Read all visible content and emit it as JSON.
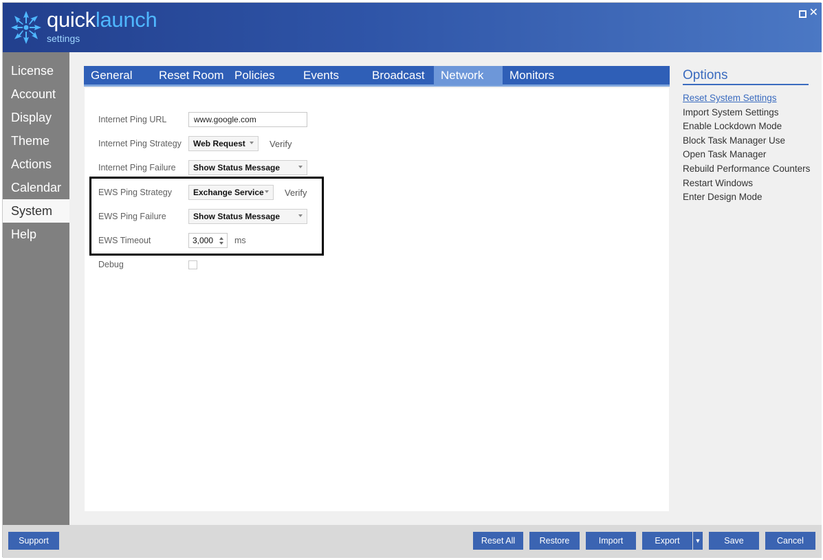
{
  "app": {
    "logo_word1": "quick",
    "logo_word2": "launch",
    "logo_subtitle": "settings",
    "window_controls": {
      "maximize_icon": "maximize-icon",
      "close_glyph": "✕"
    }
  },
  "sidebar": {
    "items": [
      {
        "label": "License"
      },
      {
        "label": "Account"
      },
      {
        "label": "Display"
      },
      {
        "label": "Theme"
      },
      {
        "label": "Actions"
      },
      {
        "label": "Calendar"
      },
      {
        "label": "System",
        "active": true
      },
      {
        "label": "Help"
      }
    ]
  },
  "tabs": [
    {
      "label": "General"
    },
    {
      "label": "Reset Room"
    },
    {
      "label": "Policies"
    },
    {
      "label": "Events"
    },
    {
      "label": "Broadcast"
    },
    {
      "label": "Network",
      "active": true
    },
    {
      "label": "Monitors"
    }
  ],
  "network": {
    "internet_ping_url": {
      "label": "Internet Ping URL",
      "value": "www.google.com"
    },
    "internet_ping_strategy": {
      "label": "Internet Ping Strategy",
      "value": "Web Request",
      "verify": "Verify"
    },
    "internet_ping_failure": {
      "label": "Internet Ping Failure",
      "value": "Show Status Message"
    },
    "ews_ping_strategy": {
      "label": "EWS Ping Strategy",
      "value": "Exchange Service",
      "verify": "Verify"
    },
    "ews_ping_failure": {
      "label": "EWS Ping Failure",
      "value": "Show Status Message"
    },
    "ews_timeout": {
      "label": "EWS Timeout",
      "value": "3,000",
      "unit": "ms"
    },
    "debug": {
      "label": "Debug",
      "checked": false
    }
  },
  "options": {
    "title": "Options",
    "items": [
      {
        "label": "Reset System Settings",
        "link": true
      },
      {
        "label": "Import System Settings"
      },
      {
        "label": "Enable Lockdown Mode"
      },
      {
        "label": "Block Task Manager Use"
      },
      {
        "label": "Open Task Manager"
      },
      {
        "label": "Rebuild Performance Counters"
      },
      {
        "label": "Restart Windows"
      },
      {
        "label": "Enter Design Mode"
      }
    ]
  },
  "footer": {
    "support": "Support",
    "reset_all": "Reset All",
    "restore": "Restore",
    "import": "Import",
    "export": "Export",
    "save": "Save",
    "cancel": "Cancel"
  },
  "colors": {
    "accent": "#2f5fb7",
    "active_tab": "#6d97d9",
    "sidebar": "#808080",
    "logo_blue": "#4fb7ff"
  }
}
